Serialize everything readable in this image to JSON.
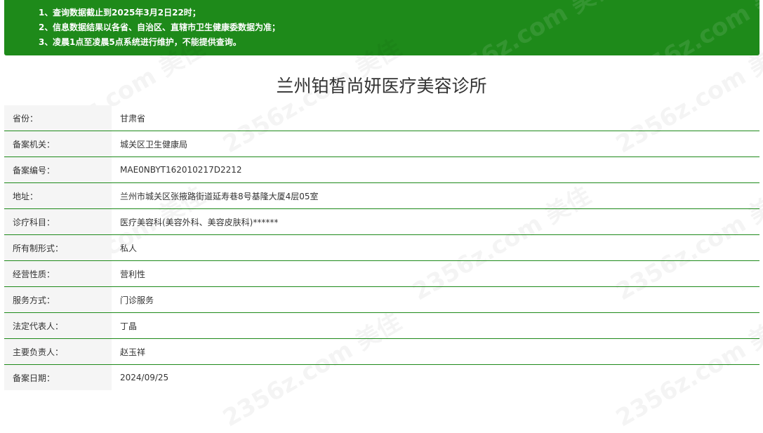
{
  "notice": {
    "items": [
      {
        "num": "1、",
        "text": "查询数据截止到2025年3月2日22时；"
      },
      {
        "num": "2、",
        "text": "信息数据结果以各省、自治区、直辖市卫生健康委数据为准；"
      },
      {
        "num": "3、",
        "text": "凌晨1点至凌晨5点系统进行维护，不能提供查询。"
      }
    ]
  },
  "page_title": "兰州铂皙尚妍医疗美容诊所",
  "fields": [
    {
      "label": "省份：",
      "value": "甘肃省"
    },
    {
      "label": "备案机关：",
      "value": "城关区卫生健康局"
    },
    {
      "label": "备案编号：",
      "value": "MAE0NBYT162010217D2212"
    },
    {
      "label": "地址：",
      "value": "兰州市城关区张掖路街道延寿巷8号基隆大厦4层05室"
    },
    {
      "label": "诊疗科目：",
      "value": "医疗美容科(美容外科、美容皮肤科)******"
    },
    {
      "label": "所有制形式：",
      "value": "私人"
    },
    {
      "label": "经营性质：",
      "value": "营利性"
    },
    {
      "label": "服务方式：",
      "value": "门诊服务"
    },
    {
      "label": "法定代表人：",
      "value": "丁晶"
    },
    {
      "label": "主要负责人：",
      "value": "赵玉祥"
    },
    {
      "label": "备案日期：",
      "value": "2024/09/25"
    }
  ],
  "watermark": {
    "text": "2356z.com 美佳"
  },
  "colors": {
    "accent": "#1e8a1a",
    "label_bg": "#f5f5f5"
  }
}
